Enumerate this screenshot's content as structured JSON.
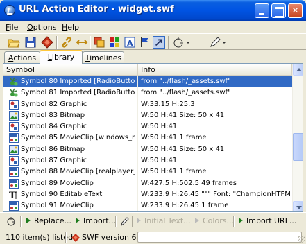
{
  "window": {
    "title": "URL Action Editor - widget.swf",
    "controls": [
      "minimize",
      "maximize",
      "close"
    ]
  },
  "menu": {
    "items": [
      "File",
      "Options",
      "Help"
    ]
  },
  "toolbar": {
    "icons": [
      "open-folder-icon",
      "save-disk-icon",
      "stop-diamond-icon",
      "link-icon",
      "swap-arrows-icon",
      "layers-icon",
      "grid-icon",
      "text-icon",
      "flag-icon",
      "cursor-arrow-icon",
      "target-dropdown-icon",
      "pen-dropdown-icon"
    ]
  },
  "tabs": [
    {
      "label": "Actions",
      "active": false
    },
    {
      "label": "Library",
      "active": true
    },
    {
      "label": "Timelines",
      "active": false
    }
  ],
  "table": {
    "columns": [
      "Symbol",
      "Info"
    ],
    "rows": [
      {
        "icon": "radiobutton-icon",
        "symbol": "Symbol 80 Imported [RadioButton]",
        "info": "from \"../flash/_assets.swf\"",
        "selected": true
      },
      {
        "icon": "radiobutton-icon",
        "symbol": "Symbol 81 Imported [RadioButton]",
        "info": "from \"../flash/_assets.swf\"",
        "selected": false
      },
      {
        "icon": "graphic-icon",
        "symbol": "Symbol 82 Graphic",
        "info": "W:33.15 H:25.3",
        "selected": false
      },
      {
        "icon": "bitmap-icon",
        "symbol": "Symbol 83 Bitmap",
        "info": "W:50 H:41  Size: 50 x 41",
        "selected": false
      },
      {
        "icon": "graphic-icon",
        "symbol": "Symbol 84 Graphic",
        "info": "W:50 H:41",
        "selected": false
      },
      {
        "icon": "movieclip-icon",
        "symbol": "Symbol 85 MovieClip [windows_m...",
        "info": "W:50 H:41  1 frame",
        "selected": false
      },
      {
        "icon": "bitmap-icon",
        "symbol": "Symbol 86 Bitmap",
        "info": "W:50 H:41  Size: 50 x 41",
        "selected": false
      },
      {
        "icon": "graphic-icon",
        "symbol": "Symbol 87 Graphic",
        "info": "W:50 H:41",
        "selected": false
      },
      {
        "icon": "movieclip-icon",
        "symbol": "Symbol 88 MovieClip [realplayer_b...",
        "info": "W:50 H:41  1 frame",
        "selected": false
      },
      {
        "icon": "movieclip-icon",
        "symbol": "Symbol 89 MovieClip",
        "info": "W:427.5 H:502.5  49 frames",
        "selected": false
      },
      {
        "icon": "edittext-icon",
        "symbol": "Symbol 90 EditableText",
        "info": "W:233.9 H:26.45  \"\"\" Font: \"ChampionHTFMi...",
        "selected": false
      },
      {
        "icon": "movieclip-icon",
        "symbol": "Symbol 91 MovieClip",
        "info": "W:233.9 H:26.45  1 frame",
        "selected": false
      }
    ]
  },
  "actionbar": {
    "replace": "Replace...",
    "import": "Import...",
    "initial_text": "Initial Text...",
    "colors": "Colors...",
    "import_url": "Import URL..."
  },
  "status": {
    "count": "110 item(s) listed",
    "version": "SWF version 6"
  },
  "colors": {
    "title_blue": "#0054e3",
    "selection": "#316ac5",
    "tab_highlight": "#ffc83c"
  }
}
